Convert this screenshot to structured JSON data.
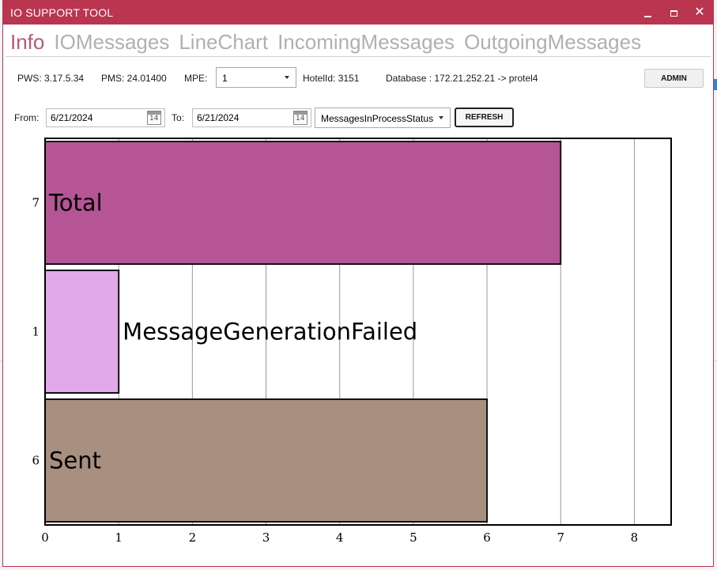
{
  "window": {
    "title": "IO SUPPORT TOOL",
    "controls": {
      "minimize": "minimize",
      "maximize": "maximize",
      "close": "✕"
    }
  },
  "tabs": [
    {
      "label": "Info",
      "active": true
    },
    {
      "label": "IOMessages",
      "active": false
    },
    {
      "label": "LineChart",
      "active": false
    },
    {
      "label": "IncomingMessages",
      "active": false
    },
    {
      "label": "OutgoingMessages",
      "active": false
    }
  ],
  "info": {
    "pws": "PWS: 3.17.5.34",
    "pms": "PMS: 24.01400",
    "mpe_label": "MPE:",
    "mpe_value": "1",
    "hotel": "HotelId: 3151",
    "database": "Database : 172.21.252.21 -> protel4",
    "admin_label": "ADMIN"
  },
  "filters": {
    "from_label": "From:",
    "from_value": "6/21/2024",
    "to_label": "To:",
    "to_value": "6/21/2024",
    "calendar_day": "14",
    "status_value": "MessagesInProcessStatus",
    "refresh_label": "REFRESH"
  },
  "colors": {
    "title_bar": "#b93550",
    "active_tab": "#b65a72",
    "total": "#b55596",
    "failed": "#e2a9e9",
    "sent": "#a88f7f"
  },
  "chart_data": {
    "type": "bar",
    "orientation": "horizontal",
    "categories": [
      "Total",
      "MessageGenerationFailed",
      "Sent"
    ],
    "values": [
      7,
      1,
      6
    ],
    "y_tick_labels": [
      "7",
      "1",
      "6"
    ],
    "x_ticks": [
      0,
      1,
      2,
      3,
      4,
      5,
      6,
      7,
      8
    ],
    "xlim": [
      0,
      8.5
    ],
    "grid": "vertical",
    "title": "",
    "xlabel": "",
    "ylabel": ""
  }
}
